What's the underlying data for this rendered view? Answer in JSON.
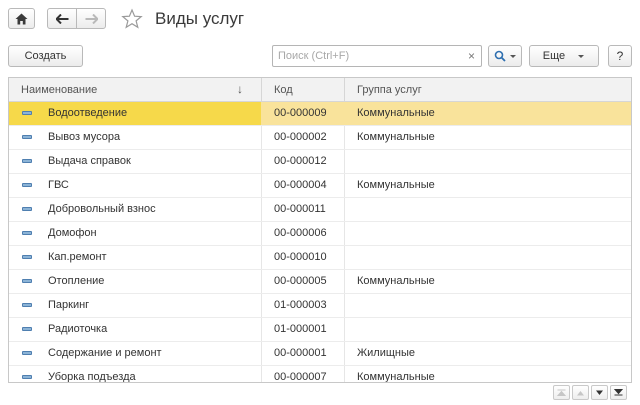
{
  "header": {
    "title": "Виды услуг",
    "home_icon": "home-icon",
    "back_icon": "arrow-left-icon",
    "forward_icon": "arrow-right-icon",
    "star_icon": "star-icon"
  },
  "toolbar": {
    "create_label": "Создать",
    "search_placeholder": "Поиск (Ctrl+F)",
    "clear_glyph": "×",
    "more_label": "Еще",
    "help_label": "?"
  },
  "table": {
    "columns": [
      "Наименование",
      "Код",
      "Группа услуг"
    ],
    "selected_color": "#f6d94a",
    "rows": [
      {
        "name": "Водоотведение",
        "code": "00-000009",
        "group": "Коммунальные",
        "selected": true
      },
      {
        "name": "Вывоз мусора",
        "code": "00-000002",
        "group": "Коммунальные"
      },
      {
        "name": "Выдача справок",
        "code": "00-000012",
        "group": ""
      },
      {
        "name": "ГВС",
        "code": "00-000004",
        "group": "Коммунальные"
      },
      {
        "name": "Добровольный взнос",
        "code": "00-000011",
        "group": ""
      },
      {
        "name": "Домофон",
        "code": "00-000006",
        "group": ""
      },
      {
        "name": "Кап.ремонт",
        "code": "00-000010",
        "group": ""
      },
      {
        "name": "Отопление",
        "code": "00-000005",
        "group": "Коммунальные"
      },
      {
        "name": "Паркинг",
        "code": "01-000003",
        "group": ""
      },
      {
        "name": "Радиоточка",
        "code": "01-000001",
        "group": ""
      },
      {
        "name": "Содержание и ремонт",
        "code": "00-000001",
        "group": "Жилищные"
      },
      {
        "name": "Уборка подъезда",
        "code": "00-000007",
        "group": "Коммунальные"
      }
    ]
  }
}
